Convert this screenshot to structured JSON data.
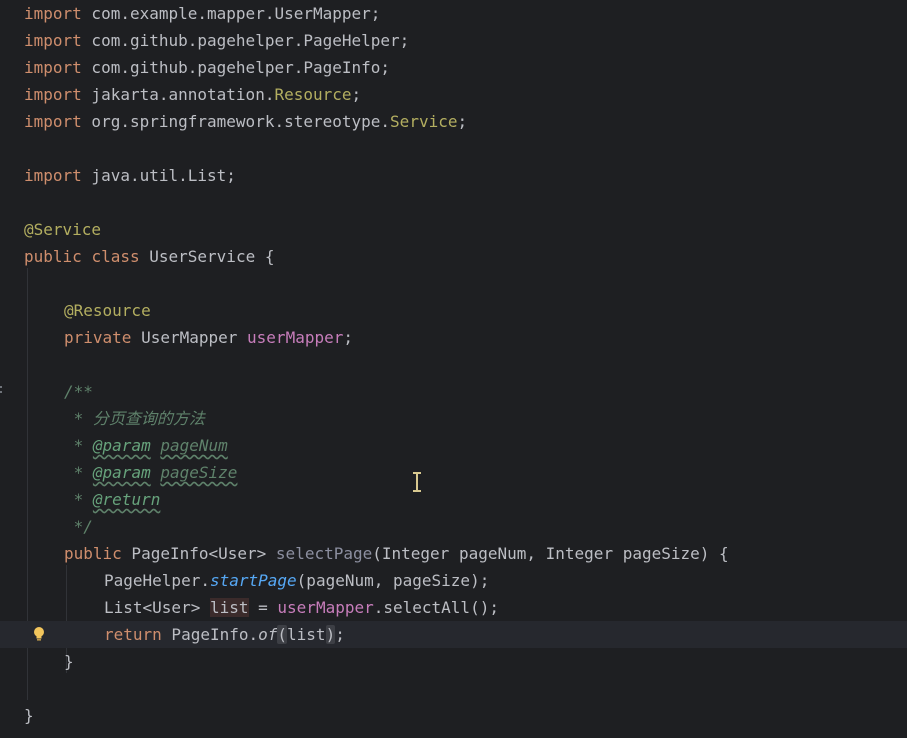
{
  "editor": {
    "lines": [
      {
        "k": "import",
        "rest": " com.example.mapper.UserMapper;"
      },
      {
        "k": "import",
        "rest": " com.github.pagehelper.PageHelper;"
      },
      {
        "k": "import",
        "rest": " com.github.pagehelper.PageInfo;"
      },
      {
        "k": "import",
        "pkg": " jakarta.annotation.",
        "cls": "Resource",
        "end": ";"
      },
      {
        "k": "import",
        "pkg": " org.springframework.stereotype.",
        "cls": "Service",
        "end": ";"
      },
      {
        "k": "import",
        "rest": " java.util.List;"
      },
      {
        "annotation": "@Service"
      },
      {
        "k1": "public",
        "k2": "class",
        "rest": " UserService {"
      },
      {
        "annotation": "@Resource"
      },
      {
        "k": "private",
        "type": " UserMapper ",
        "field": "userMapper",
        "end": ";"
      },
      {
        "doc": "/**"
      },
      {
        "star": " * ",
        "cn": "分页查询的方法"
      },
      {
        "star": " * ",
        "tag": "@param",
        "space": " ",
        "param": "pageNum"
      },
      {
        "star": " * ",
        "tag": "@param",
        "space": " ",
        "param": "pageSize"
      },
      {
        "star": " * ",
        "tag": "@return"
      },
      {
        "doc": " */"
      },
      {
        "k": "public",
        "type": " PageInfo<User> ",
        "fn": "selectPage",
        "params": "(Integer pageNum, Integer pageSize) {"
      },
      {
        "obj": "PageHelper.",
        "method": "startPage",
        "args": "(pageNum, pageSize);"
      },
      {
        "type": "List<User> ",
        "var": "list",
        "eq": " = ",
        "field": "userMapper",
        "call": ".selectAll();"
      },
      {
        "k": "return",
        "obj": " PageInfo.",
        "method": "of",
        "open": "(",
        "arg": "list",
        "close": ")",
        "end": ";"
      },
      {
        "brace": "}"
      },
      {
        "brace": "}"
      }
    ]
  },
  "icons": {
    "lightbulb": "lightbulb-icon",
    "text_cursor": "text-cursor-icon"
  },
  "colors": {
    "background": "#1e1f22",
    "keyword": "#cf8e6d",
    "annotation": "#b3ae60",
    "field": "#c77dbb",
    "doc_comment": "#5f826b",
    "default_text": "#bcbec4"
  }
}
